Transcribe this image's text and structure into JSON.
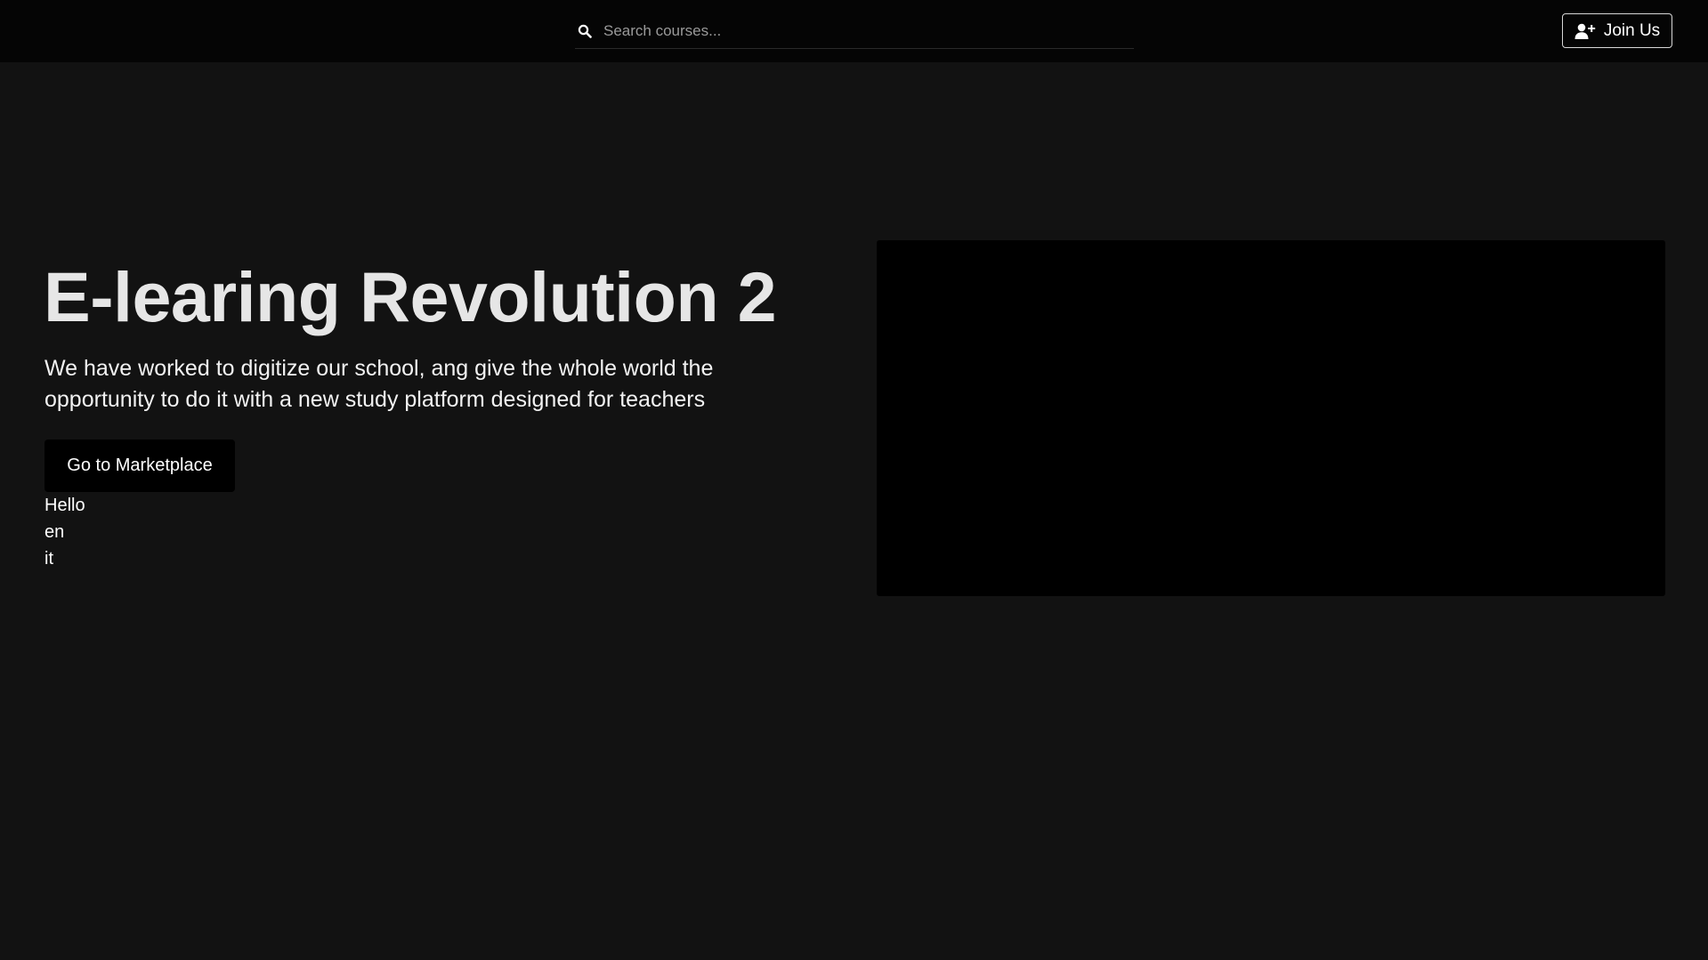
{
  "header": {
    "search": {
      "placeholder": "Search courses...",
      "value": "",
      "icon": "search-icon"
    },
    "join_button": {
      "label": "Join Us",
      "icon": "user-plus-icon"
    }
  },
  "hero": {
    "title": "E-learing Revolution 2",
    "description": "We have worked to digitize our school, ang give the whole world the opportunity to do it with a new study platform designed for teachers",
    "cta_label": "Go to Marketplace",
    "list_items": [
      "Hello",
      "en",
      "it"
    ]
  },
  "colors": {
    "page_background": "#121212",
    "topbar_background": "#050505",
    "video_background": "#000000",
    "title_text": "#e6e6e6"
  }
}
